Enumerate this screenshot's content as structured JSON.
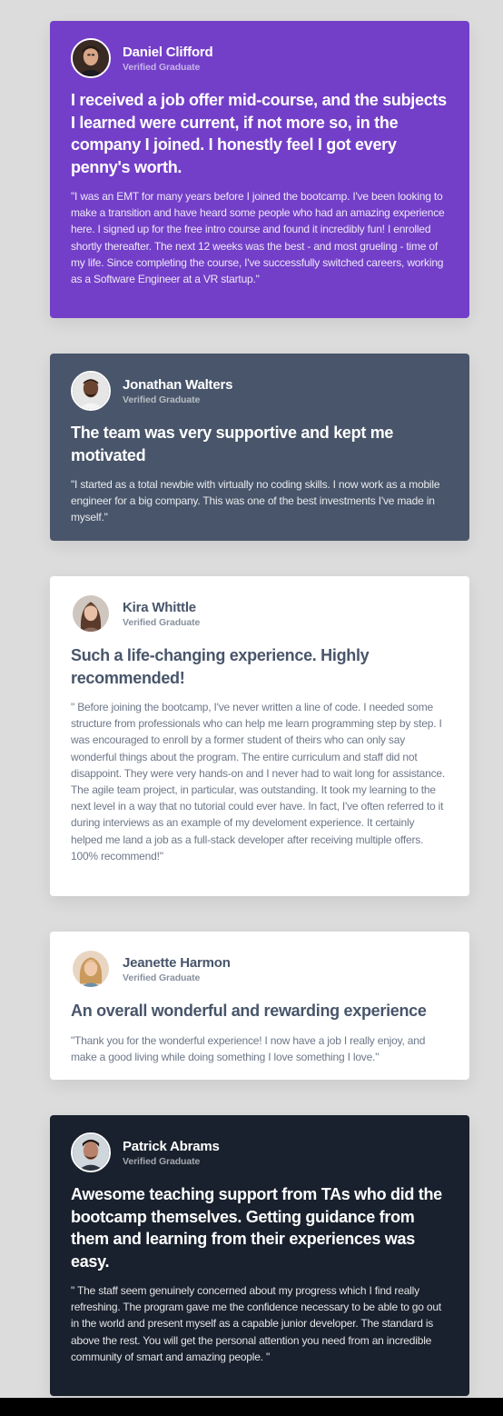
{
  "testimonials": [
    {
      "name": "Daniel Clifford",
      "role": "Verified Graduate",
      "avatar_icon": "avatar-daniel-icon",
      "headline": "I received a job offer mid-course, and the subjects I learned were current, if not more so, in the company I joined. I honestly feel I got every penny's worth.",
      "quote": "\"I was an EMT for many years before I joined the bootcamp. I've been looking to make a transition and have heard some people who had an amazing experience here. I signed up for the free intro course and found it incredibly fun! I enrolled shortly thereafter. The next 12 weeks was the best - and most grueling - time of my life. Since completing the course, I've successfully switched careers, working as a Software Engineer at a VR startup.\""
    },
    {
      "name": "Jonathan Walters",
      "role": "Verified Graduate",
      "avatar_icon": "avatar-jonathan-icon",
      "headline": "The team was very supportive and kept me motivated",
      "quote": "\"I started as a total newbie with virtually no coding skills. I now work as a mobile engineer for a big company. This was one of the best investments I've made in myself.\""
    },
    {
      "name": "Kira Whittle",
      "role": "Verified Graduate",
      "avatar_icon": "avatar-kira-icon",
      "headline": "Such a life-changing experience. Highly recommended!",
      "quote": "\" Before joining the bootcamp, I've never written a line of code. I needed some structure from professionals who can help me learn programming step by step. I was encouraged to enroll by a former student of theirs who can only say wonderful things about the program. The entire curriculum and staff did not disappoint. They were very hands-on and I never had to wait long for assistance. The agile team project, in particular, was outstanding. It took my learning to the next level in a way that no tutorial could ever have. In fact, I've often referred to it during interviews as an example of my develoment experience. It certainly helped me land a job as a full-stack developer after receiving multiple offers. 100% recommend!\""
    },
    {
      "name": "Jeanette Harmon",
      "role": "Verified Graduate",
      "avatar_icon": "avatar-jeanette-icon",
      "headline": "An overall wonderful and rewarding experience",
      "quote": "\"Thank you for the wonderful experience! I now have a job I really enjoy, and make a good living while doing something I love something I love.\""
    },
    {
      "name": "Patrick Abrams",
      "role": "Verified Graduate",
      "avatar_icon": "avatar-patrick-icon",
      "headline": "Awesome teaching support from TAs who did the bootcamp themselves. Getting guidance from them and learning from their experiences was easy.",
      "quote": "\" The staff seem genuinely concerned about my progress which I find really refreshing. The program gave me the confidence necessary to be able to go out in the world and present myself as a capable junior developer. The standard is above the rest. You will get the personal attention you need from an incredible community of smart and amazing people. \""
    }
  ],
  "colors": {
    "purple": "#733fc8",
    "slate": "#48556a",
    "white": "#ffffff",
    "dark": "#19212e",
    "background": "#dcdcdc"
  }
}
